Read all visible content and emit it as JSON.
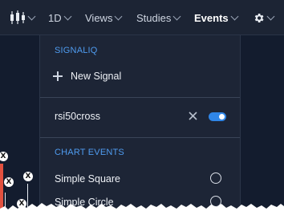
{
  "toolbar": {
    "timeframe": "1D",
    "views": "Views",
    "studies": "Studies",
    "events": "Events"
  },
  "events_menu": {
    "signaliq": {
      "title": "SIGNALIQ",
      "new_signal": "New Signal",
      "signals": [
        {
          "name": "rsi50cross",
          "enabled": true
        }
      ]
    },
    "chart_events": {
      "title": "CHART EVENTS",
      "items": [
        {
          "label": "Simple Square",
          "selected": false
        },
        {
          "label": "Simple Circle",
          "selected": false
        }
      ]
    }
  },
  "chart": {
    "event_marker_glyph": "X"
  },
  "colors": {
    "accent": "#4f9cf0",
    "toggle_on": "#2f86e8",
    "panel_bg": "#1d2536",
    "chart_bg": "#131c2e",
    "candle_down": "#e2513f"
  }
}
